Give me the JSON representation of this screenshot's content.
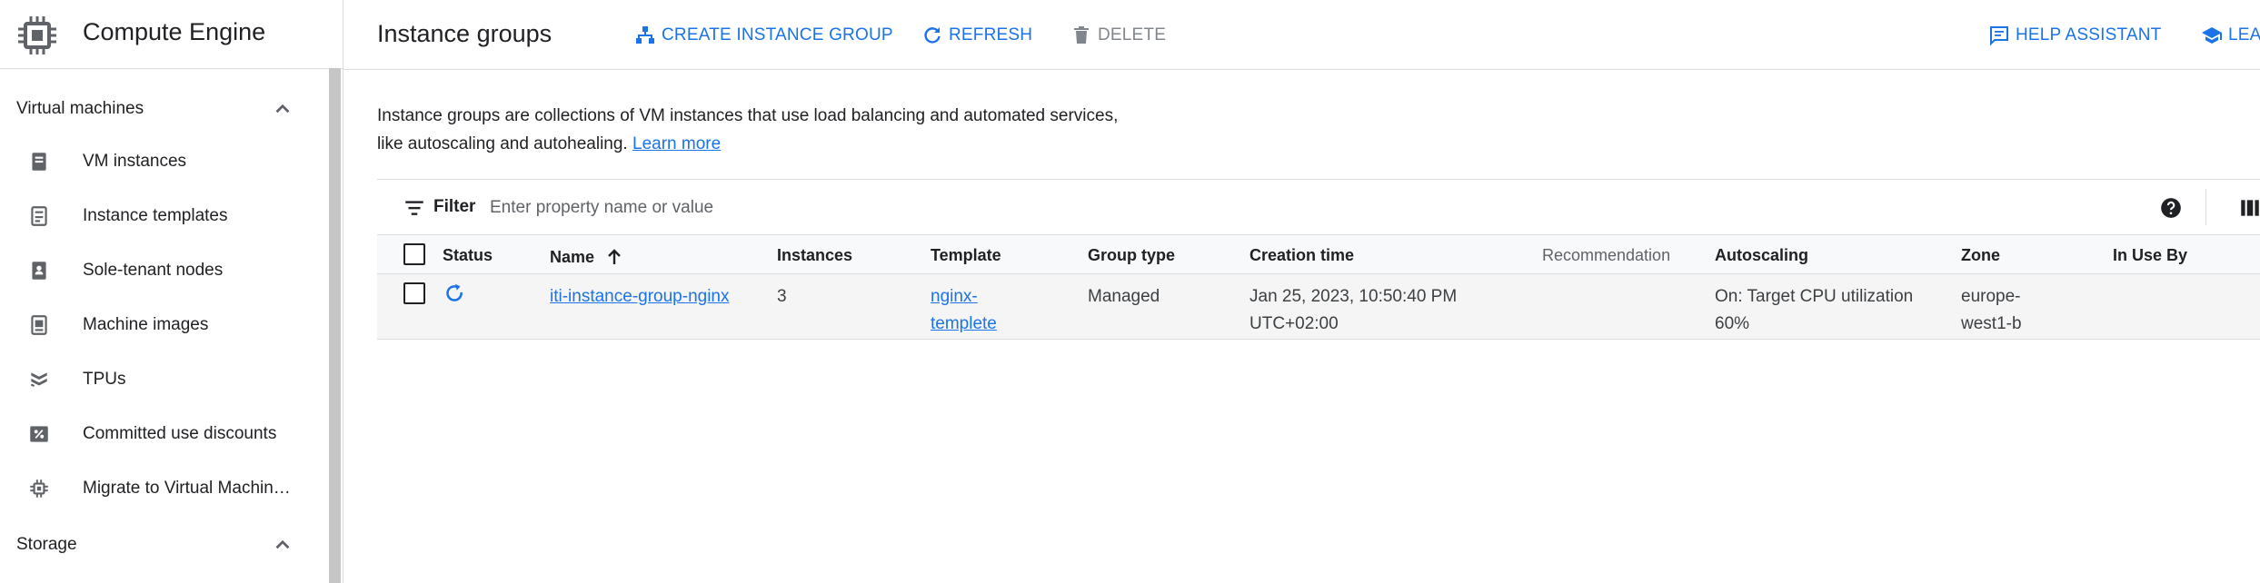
{
  "sidebar": {
    "product_title": "Compute Engine",
    "sections": [
      {
        "label": "Virtual machines",
        "icon": "chevron-up-icon"
      },
      {
        "label": "Storage",
        "icon": "chevron-up-icon"
      }
    ],
    "items": [
      {
        "label": "VM instances",
        "icon": "vm-instances-icon"
      },
      {
        "label": "Instance templates",
        "icon": "instance-templates-icon"
      },
      {
        "label": "Sole-tenant nodes",
        "icon": "sole-tenant-nodes-icon"
      },
      {
        "label": "Machine images",
        "icon": "machine-images-icon"
      },
      {
        "label": "TPUs",
        "icon": "tpu-icon"
      },
      {
        "label": "Committed use discounts",
        "icon": "percent-icon"
      },
      {
        "label": "Migrate to Virtual Machin…",
        "icon": "migrate-icon"
      }
    ]
  },
  "header": {
    "title": "Instance groups",
    "create_label": "CREATE INSTANCE GROUP",
    "refresh_label": "REFRESH",
    "delete_label": "DELETE",
    "help_label": "HELP ASSISTANT",
    "learn_label": "LEA"
  },
  "description": {
    "text": "Instance groups are collections of VM instances that use load balancing and automated services, like autoscaling and autohealing.",
    "link": "Learn more"
  },
  "filter": {
    "label": "Filter",
    "placeholder": "Enter property name or value"
  },
  "table": {
    "headers": {
      "status": "Status",
      "name": "Name",
      "instances": "Instances",
      "template": "Template",
      "group_type": "Group type",
      "creation_time": "Creation time",
      "recommendation": "Recommendation",
      "autoscaling": "Autoscaling",
      "zone": "Zone",
      "in_use_by": "In Use By"
    },
    "sort": {
      "column": "Name",
      "direction": "ascending"
    },
    "rows": [
      {
        "status_icon": "status-updating-icon",
        "name": "iti-instance-group-nginx",
        "instances": "3",
        "template": "nginx-templete",
        "template_line1": "nginx-",
        "template_line2": "templete",
        "group_type": "Managed",
        "creation_time_line1": "Jan 25, 2023, 10:50:40 PM",
        "creation_time_line2": "UTC+02:00",
        "recommendation": "",
        "autoscaling_line1": "On: Target CPU utilization",
        "autoscaling_line2": "60%",
        "zone_line1": "europe-",
        "zone_line2": "west1-b",
        "in_use_by": ""
      }
    ]
  },
  "colors": {
    "accent": "#1a73e8",
    "text": "#202124",
    "muted": "#5f6368",
    "disabled": "#80868b",
    "border": "#dadce0",
    "row_bg": "#f5f5f5"
  }
}
